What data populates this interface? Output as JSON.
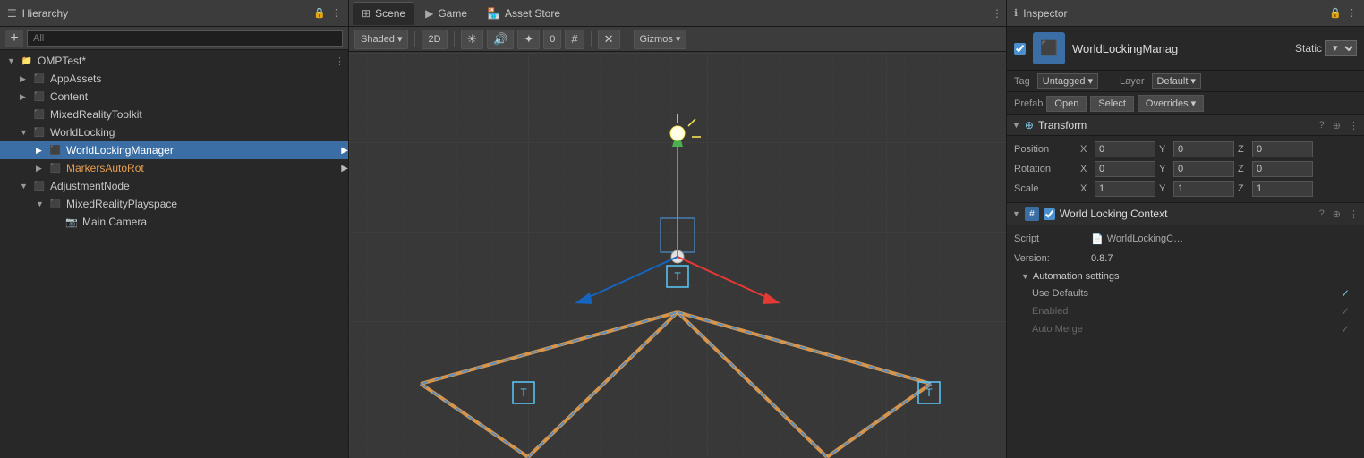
{
  "hierarchy": {
    "title": "Hierarchy",
    "search_placeholder": "All",
    "items": [
      {
        "id": "omptst",
        "label": "OMPTest*",
        "indent": 0,
        "arrow": "▼",
        "icon": "cube",
        "selected": false,
        "has_dots": true
      },
      {
        "id": "appassets",
        "label": "AppAssets",
        "indent": 1,
        "arrow": "▶",
        "icon": "folder",
        "selected": false
      },
      {
        "id": "content",
        "label": "Content",
        "indent": 1,
        "arrow": "▶",
        "icon": "folder",
        "selected": false
      },
      {
        "id": "mixedrealitytoolkit",
        "label": "MixedRealityToolkit",
        "indent": 1,
        "arrow": "",
        "icon": "cube",
        "selected": false
      },
      {
        "id": "worldlocking",
        "label": "WorldLocking",
        "indent": 1,
        "arrow": "▼",
        "icon": "folder",
        "selected": false
      },
      {
        "id": "worldlockingmanager",
        "label": "WorldLockingManager",
        "indent": 2,
        "arrow": "▶",
        "icon": "cube",
        "selected": true,
        "color": "white"
      },
      {
        "id": "markersautorot",
        "label": "MarkersAutoRot",
        "indent": 2,
        "arrow": "▶",
        "icon": "cube",
        "selected": false,
        "color": "orange"
      },
      {
        "id": "adjustmentnode",
        "label": "AdjustmentNode",
        "indent": 1,
        "arrow": "▼",
        "icon": "cube",
        "selected": false
      },
      {
        "id": "mixedrealityplayspace",
        "label": "MixedRealityPlayspace",
        "indent": 2,
        "arrow": "▼",
        "icon": "cube",
        "selected": false
      },
      {
        "id": "maincamera",
        "label": "Main Camera",
        "indent": 3,
        "arrow": "",
        "icon": "cam",
        "selected": false
      }
    ]
  },
  "scene": {
    "tabs": [
      {
        "id": "scene",
        "label": "Scene",
        "icon": "⊞",
        "active": true
      },
      {
        "id": "game",
        "label": "Game",
        "icon": "▶",
        "active": false
      },
      {
        "id": "asset_store",
        "label": "Asset Store",
        "icon": "🏪",
        "active": false
      }
    ],
    "toolbar": {
      "shading": "Shaded",
      "mode_2d": "2D",
      "gizmos": "Gizmos"
    },
    "tab_dots_label": "⋮"
  },
  "inspector": {
    "title": "Inspector",
    "object_name": "WorldLockingManag",
    "static_label": "Static",
    "tag_label": "Tag",
    "tag_value": "Untagged",
    "layer_label": "Layer",
    "layer_value": "Default",
    "prefab_label": "Prefab",
    "open_label": "Open",
    "select_label": "Select",
    "overrides_label": "Overrides",
    "transform": {
      "label": "Transform",
      "position_label": "Position",
      "rotation_label": "Rotation",
      "scale_label": "Scale",
      "pos_x": "0",
      "pos_y": "0",
      "pos_z": "0",
      "rot_x": "0",
      "rot_y": "0",
      "rot_z": "0",
      "scale_x": "1",
      "scale_y": "1",
      "scale_z": "1"
    },
    "wlc": {
      "label": "World Locking Context",
      "script_label": "Script",
      "script_value": "WorldLockingC…",
      "version_label": "Version:",
      "version_value": "0.8.7",
      "automation_label": "Automation settings",
      "use_defaults_label": "Use Defaults",
      "enabled_label": "Enabled",
      "auto_merge_label": "Auto Merge",
      "checkmark": "✓"
    }
  }
}
